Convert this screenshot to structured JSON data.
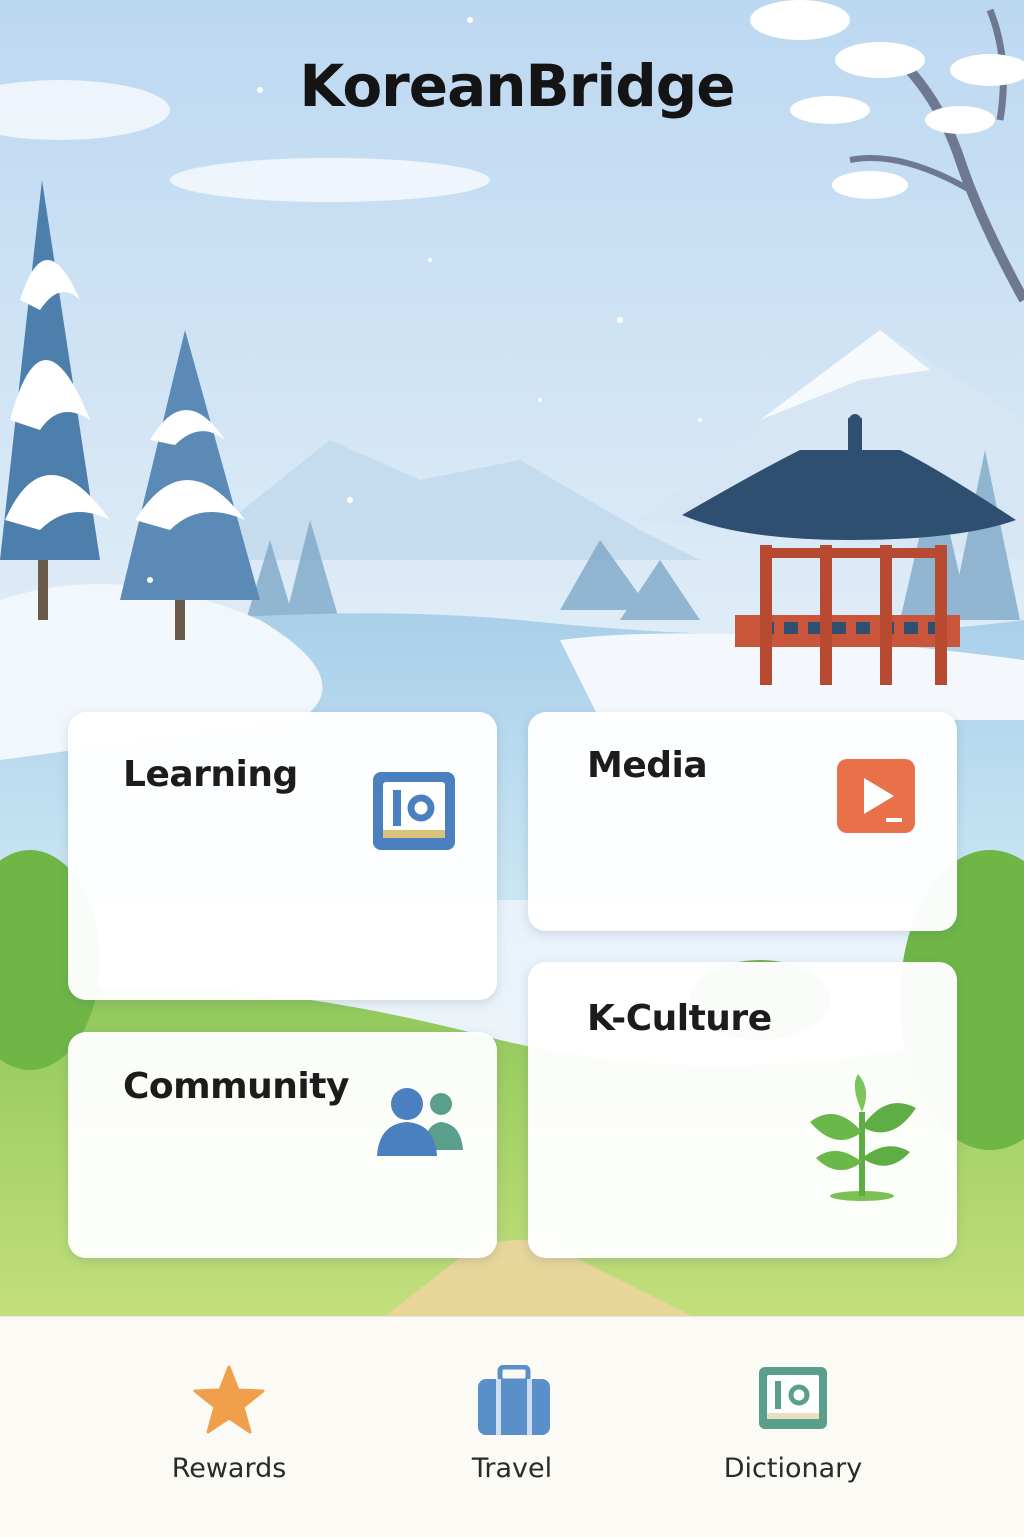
{
  "app": {
    "title": "KoreanBridge"
  },
  "cards": {
    "learning": {
      "label": "Learning",
      "icon": "book-icon",
      "color": "#4a80bf"
    },
    "media": {
      "label": "Media",
      "icon": "play-icon",
      "color": "#e8714a"
    },
    "community": {
      "label": "Community",
      "icon": "people-icon",
      "color": "#4b7fc0"
    },
    "kculture": {
      "label": "K-Culture",
      "icon": "sprout-icon",
      "color": "#5fae45"
    }
  },
  "bottom_nav": {
    "items": [
      {
        "label": "Rewards",
        "icon": "star-icon",
        "color": "#f0a04a"
      },
      {
        "label": "Travel",
        "icon": "suitcase-icon",
        "color": "#5b8fc9"
      },
      {
        "label": "Dictionary",
        "icon": "dictionary-icon",
        "color": "#5a9e8c"
      }
    ]
  },
  "colors": {
    "sky": "#cfe3f5",
    "snow": "#f4f8fc",
    "water": "#b8d8ee",
    "grass": "#9ccf5f",
    "pavilion_roof": "#2f4f70",
    "pavilion_wood": "#c9553a"
  }
}
